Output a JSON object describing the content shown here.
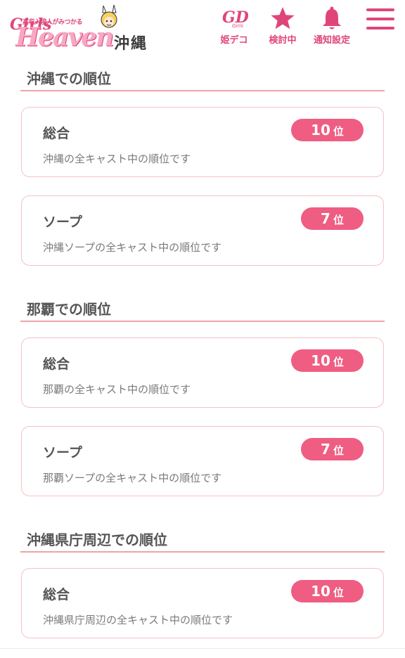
{
  "header": {
    "logo": {
      "tagline": "高収入求人がみつかる",
      "brand_script": "Girls",
      "brand_word": "Heaven",
      "region": "沖縄"
    },
    "buttons": [
      {
        "label": "姫デコ",
        "icon": "hime-deco-icon"
      },
      {
        "label": "検討中",
        "icon": "star-icon"
      },
      {
        "label": "通知設定",
        "icon": "bell-icon"
      }
    ],
    "menu_icon": "hamburger-icon",
    "accent_color": "#e0457a"
  },
  "sections": [
    {
      "title": "沖縄での順位",
      "cards": [
        {
          "title": "総合",
          "rank": "10",
          "unit": "位",
          "desc": "沖縄の全キャスト中の順位です"
        },
        {
          "title": "ソープ",
          "rank": "7",
          "unit": "位",
          "desc": "沖縄ソープの全キャスト中の順位です"
        }
      ]
    },
    {
      "title": "那覇での順位",
      "cards": [
        {
          "title": "総合",
          "rank": "10",
          "unit": "位",
          "desc": "那覇の全キャスト中の順位です"
        },
        {
          "title": "ソープ",
          "rank": "7",
          "unit": "位",
          "desc": "那覇ソープの全キャスト中の順位です"
        }
      ]
    },
    {
      "title": "沖縄県庁周辺での順位",
      "cards": [
        {
          "title": "総合",
          "rank": "10",
          "unit": "位",
          "desc": "沖縄県庁周辺の全キャスト中の順位です"
        }
      ]
    }
  ],
  "colors": {
    "badge": "#ef5d82",
    "rule": "#f0a3a8",
    "card_border": "#f3c2c6"
  }
}
